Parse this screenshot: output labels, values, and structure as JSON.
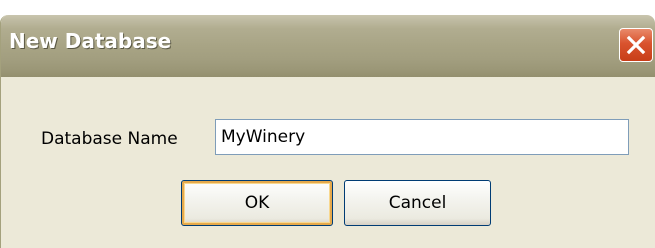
{
  "dialog": {
    "title": "New Database",
    "close_icon": "close-x-icon",
    "close_color": "#d9532e",
    "field_label": "Database Name",
    "field_value": "MyWinery",
    "ok_label": "OK",
    "cancel_label": "Cancel"
  }
}
